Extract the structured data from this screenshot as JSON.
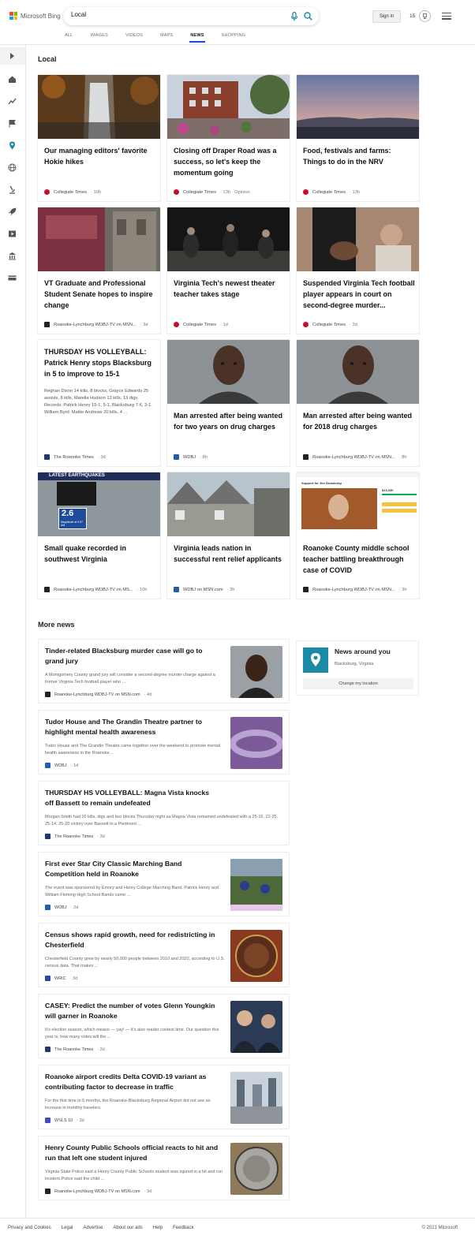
{
  "header": {
    "logo_text": "Microsoft Bing",
    "search_value": "Local",
    "signin_label": "Sign in",
    "rewards_count": "15",
    "tabs": [
      {
        "label": "ALL"
      },
      {
        "label": "IMAGES"
      },
      {
        "label": "VIDEOS"
      },
      {
        "label": "MAPS"
      },
      {
        "label": "NEWS",
        "active": true
      },
      {
        "label": "SHOPPING"
      }
    ]
  },
  "sidebar": {
    "icons": [
      "expand-arrow-icon",
      "home-icon",
      "trending-icon",
      "flag-icon",
      "location-pin-icon",
      "globe-icon",
      "microscope-icon",
      "rocket-icon",
      "video-icon",
      "bank-icon",
      "money-icon"
    ]
  },
  "local": {
    "title": "Local",
    "cards": [
      {
        "title": "Our managing editors' favorite Hokie hikes",
        "source": "Collegiate Times",
        "time": "10h",
        "extra": ""
      },
      {
        "title": "Closing off Draper Road was a success, so let's keep the momentum going",
        "source": "Collegiate Times",
        "time": "13h · Opinion",
        "extra": ""
      },
      {
        "title": "Food, festivals and farms: Things to do in the NRV",
        "source": "Collegiate Times",
        "time": "13h",
        "extra": ""
      },
      {
        "title": "VT Graduate and Professional Student Senate hopes to inspire change",
        "source": "Roanoke-Lynchburg WDBJ-TV on MSN...",
        "time": "3d",
        "extra": ""
      },
      {
        "title": "Virginia Tech's newest theater teacher takes stage",
        "source": "Collegiate Times",
        "time": "1d",
        "extra": ""
      },
      {
        "title": "Suspended Virginia Tech football player appears in court on second-degree murder...",
        "source": "Collegiate Times",
        "time": "3d",
        "extra": ""
      },
      {
        "title": "THURSDAY HS VOLLEYBALL: Patrick Henry stops Blacksburg in 5 to improve to 15-1",
        "snippet": "Reghan Dixon 14 kills, 8 blocks, Grayce Edwards 25 assists, 8 kills, Marella Hudson 13 kills, 13 digs. Records: Patrick Henry 15-1, 5-1, Blacksburg 7-6, 3-1. William Byrd: Mattie Andrews 20 kills, 4 ...",
        "source": "The Roanoke Times",
        "time": "3d",
        "extra": ""
      },
      {
        "title": "Man arrested after being wanted for two years on drug charges",
        "source": "WDBJ",
        "time": "8h",
        "extra": ""
      },
      {
        "title": "Man arrested after being wanted for 2018 drug charges",
        "source": "Roanoke-Lynchburg WDBJ-TV on MSN...",
        "time": "8h",
        "extra": ""
      },
      {
        "title": "Small quake recorded in southwest Virginia",
        "source": "Roanoke-Lynchburg WDBJ-TV on MS...",
        "time": "10h",
        "extra": "LATEST EARTHQUAKES",
        "magnitude": "2.6",
        "mag_label": "Magnitude at 9:37 AM"
      },
      {
        "title": "Virginia leads nation in successful rent relief applicants",
        "source": "WDBJ on MSN.com",
        "time": "3h",
        "extra": ""
      },
      {
        "title": "Roanoke County middle school teacher battling breakthrough case of COVID",
        "source": "Roanoke-Lynchburg WDBJ-TV on MSN...",
        "time": "3h",
        "extra": "Support for Jim Straulesky",
        "amount": "$13,330"
      }
    ]
  },
  "more_news": {
    "title": "More news",
    "items": [
      {
        "title": "Tinder-related Blacksburg murder case will go to grand jury",
        "snippet": "A Montgomery County grand jury will consider a second-degree murder charge against a former Virginia Tech football player who ...",
        "source": "Roanoke-Lynchburg WDBJ-TV on MSN.com",
        "time": "4d"
      },
      {
        "title": "Tudor House and The Grandin Theatre partner to highlight mental health awareness",
        "snippet": "Tudor House and The Grandin Theatre came together over the weekend to promote mental health awareness in the Roanoke ...",
        "source": "WDBJ",
        "time": "1d"
      },
      {
        "title": "THURSDAY HS VOLLEYBALL: Magna Vista knocks off Bassett to remain undefeated",
        "snippet": "Morgan Smith had 20 kills, digs and two blocks Thursday night as Magna Vista remained undefeated with a 25-16, 22-25, 25-14, 25-20 victory over Bassett in a Piedmont ...",
        "source": "The Roanoke Times",
        "time": "3d"
      },
      {
        "title": "First ever Star City Classic Marching Band Competition held in Roanoke",
        "snippet": "The event was sponsored by Emory and Henry College Marching Band. Patrick Henry and William Fleming High School Bands came ...",
        "source": "WDBJ",
        "time": "2d"
      },
      {
        "title": "Census shows rapid growth, need for redistricting in Chesterfield",
        "snippet": "Chesterfield County grew by nearly 50,000 people between 2010 and 2020, according to U.S. census data. That makes ...",
        "source": "WRIC",
        "time": "3d"
      },
      {
        "title": "CASEY: Predict the number of votes Glenn Youngkin will garner in Roanoke",
        "snippet": "It's election season, which means — yay! — it's also reader contest time. Our question this year is, how many votes will the ...",
        "source": "The Roanoke Times",
        "time": "2d"
      },
      {
        "title": "Roanoke airport credits Delta COVID-19 variant as contributing factor to decrease in traffic",
        "snippet": "For the first time in 6 months, the Roanoke-Blacksburg Regional Airport did not see an increase in monthly travelers.",
        "source": "WSLS 10",
        "time": "3d"
      },
      {
        "title": "Henry County Public Schools official reacts to hit and run that left one student injured",
        "snippet": "Virginia State Police said a Henry County Public Schools student was injured in a hit and run incident.Police said the child ...",
        "source": "Roanoke-Lynchburg WDBJ-TV on MSN.com",
        "time": "3d"
      }
    ]
  },
  "news_around": {
    "title": "News around you",
    "location": "Blacksburg, Virginia",
    "button": "Change my location"
  },
  "footer": {
    "links": [
      "Privacy and Cookies",
      "Legal",
      "Advertise",
      "About our ads",
      "Help",
      "Feedback"
    ],
    "copyright": "© 2021 Microsoft"
  },
  "colors": {
    "accent": "#174ae4",
    "search_blue": "#1b8aa5",
    "collegiate_times": "#c8102e",
    "wdbj": "#1f5fae"
  }
}
